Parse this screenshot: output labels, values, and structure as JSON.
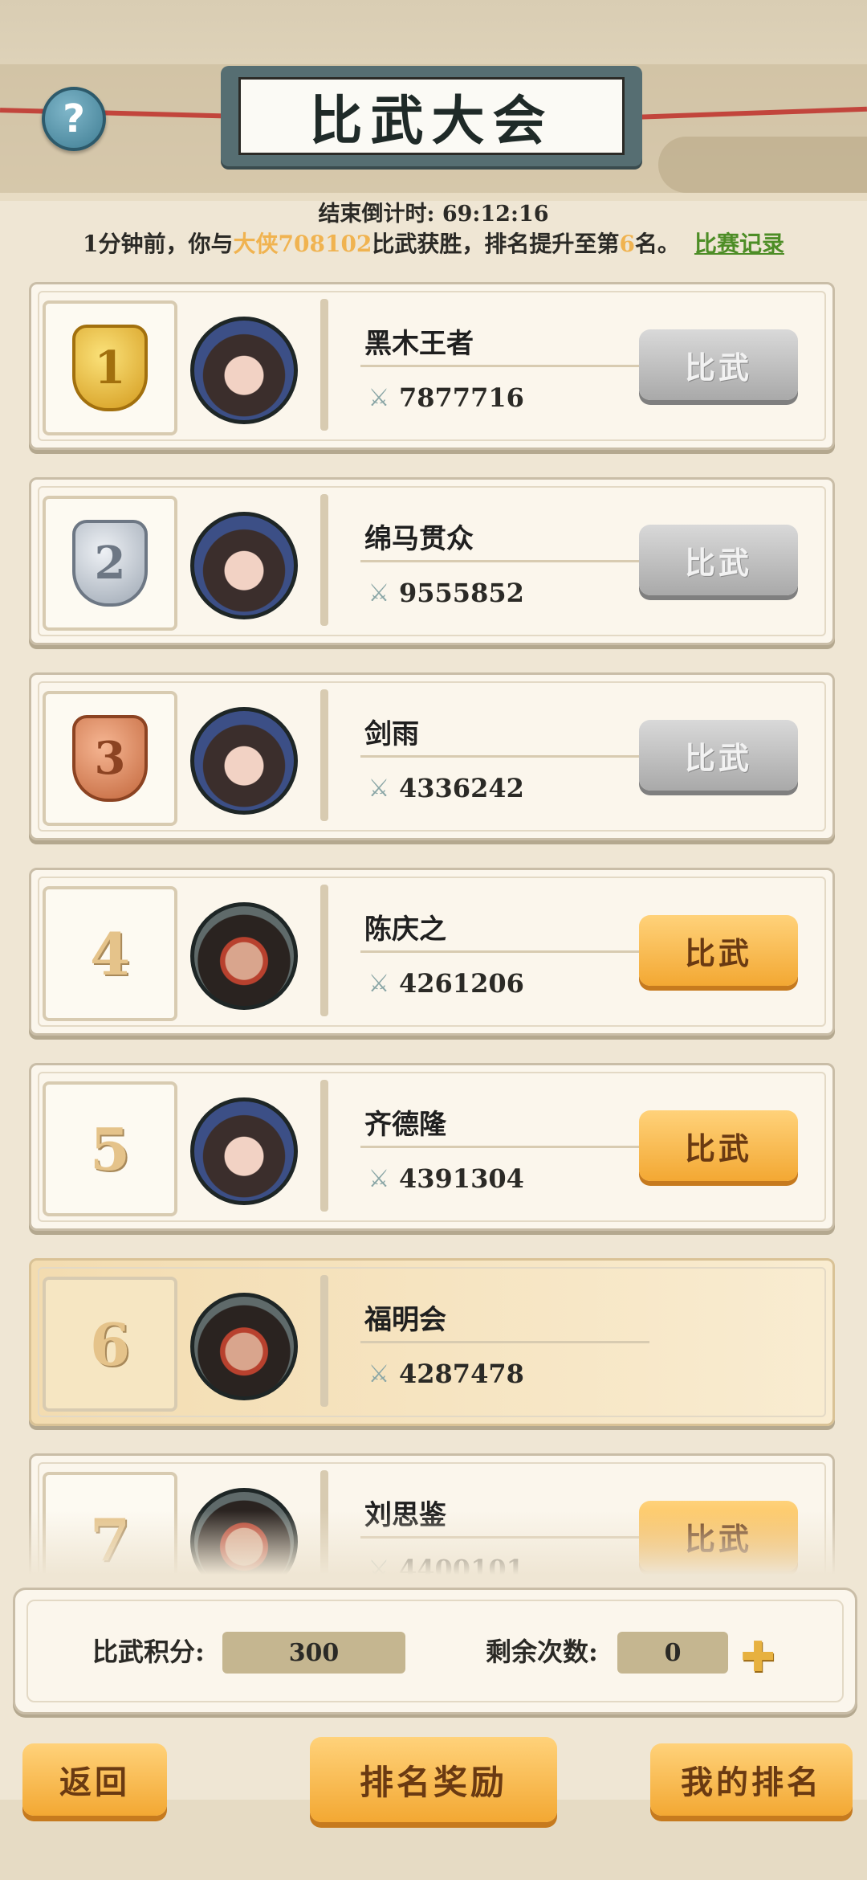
{
  "header": {
    "title": "比武大会",
    "help_icon": "question-mark",
    "countdown_label": "结束倒计时:",
    "countdown_value": "69:12:16"
  },
  "notice": {
    "prefix": "1分钟前，你与",
    "opponent": "大侠708102",
    "middle": "比武获胜，排名提升至第",
    "rank": "6",
    "suffix": "名。",
    "record_link": "比赛记录"
  },
  "leaderboard": [
    {
      "rank": "1",
      "medal": "gold",
      "avatar": "female",
      "name": "黑木王者",
      "power": "7877716",
      "button": "比武",
      "button_state": "disabled",
      "is_mine": false
    },
    {
      "rank": "2",
      "medal": "silver",
      "avatar": "female",
      "name": "绵马贯众",
      "power": "9555852",
      "button": "比武",
      "button_state": "disabled",
      "is_mine": false
    },
    {
      "rank": "3",
      "medal": "bronze",
      "avatar": "female",
      "name": "剑雨",
      "power": "4336242",
      "button": "比武",
      "button_state": "disabled",
      "is_mine": false
    },
    {
      "rank": "4",
      "medal": "none",
      "avatar": "male",
      "name": "陈庆之",
      "power": "4261206",
      "button": "比武",
      "button_state": "active",
      "is_mine": false
    },
    {
      "rank": "5",
      "medal": "none",
      "avatar": "female",
      "name": "齐德隆",
      "power": "4391304",
      "button": "比武",
      "button_state": "active",
      "is_mine": false
    },
    {
      "rank": "6",
      "medal": "none",
      "avatar": "male",
      "name": "福明会",
      "power": "4287478",
      "button": "",
      "button_state": "none",
      "is_mine": true
    },
    {
      "rank": "7",
      "medal": "none",
      "avatar": "male",
      "name": "刘思鉴",
      "power": "4400101",
      "button": "比武",
      "button_state": "active",
      "is_mine": false
    }
  ],
  "stats": {
    "points_label": "比武积分:",
    "points_value": "300",
    "remaining_label": "剩余次数:",
    "remaining_value": "0",
    "add_icon": "plus"
  },
  "footer": {
    "back_label": "返回",
    "rewards_label": "排名奖励",
    "my_rank_label": "我的排名"
  },
  "colors": {
    "accent_orange": "#f3a833",
    "highlight_text": "#f0b350",
    "link_green": "#4d8d26",
    "disabled_gray": "#a9a9a9"
  }
}
